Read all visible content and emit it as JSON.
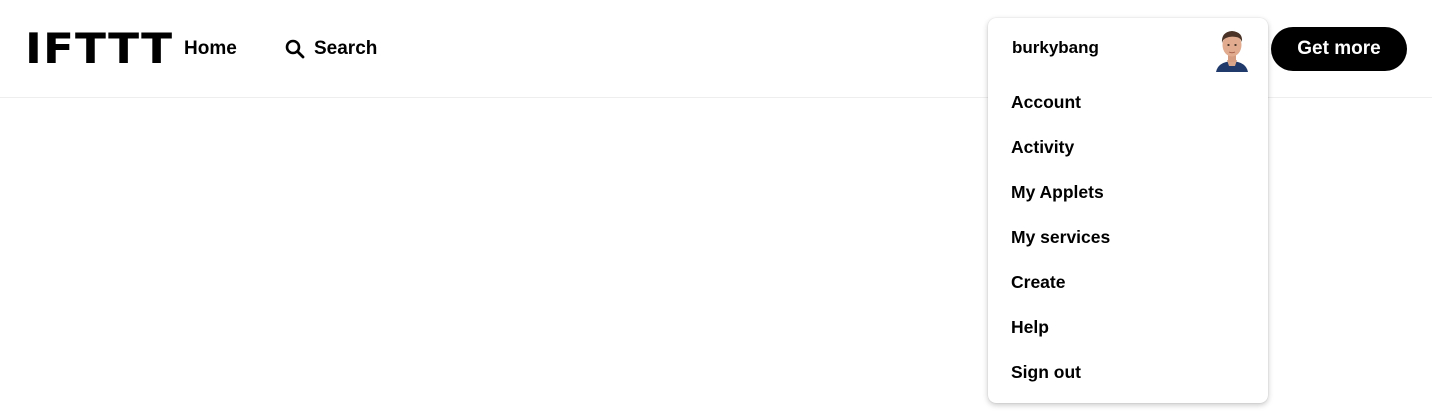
{
  "header": {
    "logo_text": "IFTTT",
    "nav": {
      "home_label": "Home",
      "search_label": "Search"
    },
    "cta_label": "Get more"
  },
  "user_menu": {
    "username": "burkybang",
    "items": [
      {
        "label": "Account"
      },
      {
        "label": "Activity"
      },
      {
        "label": "My Applets"
      },
      {
        "label": "My services"
      },
      {
        "label": "Create"
      },
      {
        "label": "Help"
      },
      {
        "label": "Sign out"
      }
    ]
  },
  "colors": {
    "text": "#000000",
    "button_bg": "#000000",
    "button_text": "#ffffff",
    "divider": "#eeeeee"
  },
  "icons": {
    "search": "search-icon",
    "avatar": "user-avatar"
  }
}
